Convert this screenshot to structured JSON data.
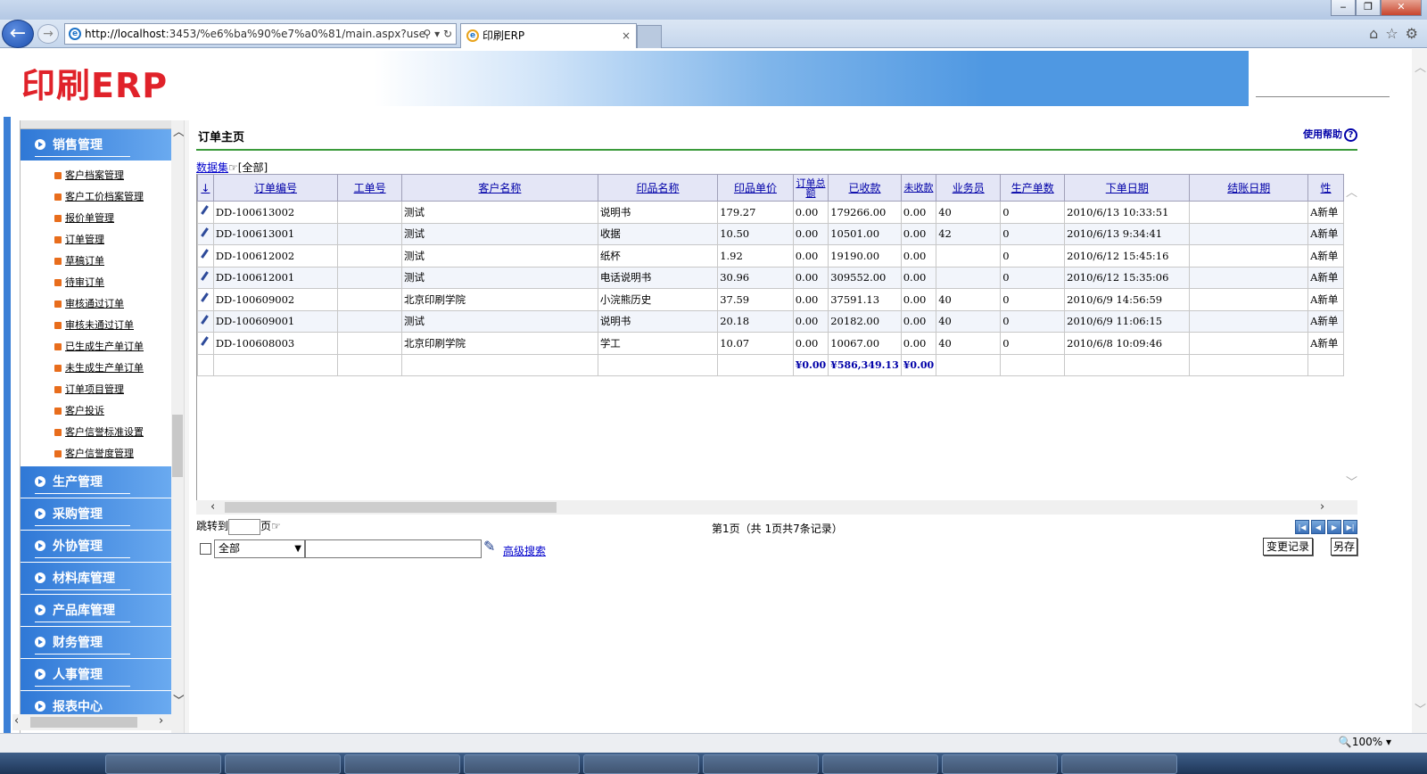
{
  "browser": {
    "address": "http://localhost:3453/%e6%ba%90%e7%a0%81/main.aspx?use",
    "address_host": "http://localhost",
    "address_rest": ":3453/%e6%ba%90%e7%a0%81/main.aspx?use",
    "tab_title": "印刷ERP",
    "zoom": "100%"
  },
  "header": {
    "logo": "印刷ERP"
  },
  "sidebar": {
    "sections": [
      {
        "label": "销售管理"
      },
      {
        "label": "生产管理"
      },
      {
        "label": "采购管理"
      },
      {
        "label": "外协管理"
      },
      {
        "label": "材料库管理"
      },
      {
        "label": "产品库管理"
      },
      {
        "label": "财务管理"
      },
      {
        "label": "人事管理"
      },
      {
        "label": "报表中心"
      }
    ],
    "sales_items": [
      "客户档案管理",
      "客户工价档案管理",
      "报价单管理",
      "订单管理",
      "草稿订单",
      "待审订单",
      "审核通过订单",
      "审核未通过订单",
      "已生成生产单订单",
      "未生成生产单订单",
      "订单项目管理",
      "客户投诉",
      "客户信誉标准设置",
      "客户信誉度管理"
    ]
  },
  "main": {
    "title": "订单主页",
    "help": "使用帮助",
    "dataset_label": "数据集",
    "dataset_value": "[全部]",
    "columns": [
      "↓",
      "订单编号",
      "工单号",
      "客户名称",
      "印品名称",
      "印品单价",
      "订单总额",
      "已收款",
      "未收款",
      "业务员",
      "生产单数",
      "下单日期",
      "结账日期",
      "性"
    ],
    "rows": [
      [
        "DD-100613002",
        "",
        "测试",
        "说明书",
        "179.27",
        "0.00",
        "179266.00",
        "0.00",
        "40",
        "0",
        "2010/6/13 10:33:51",
        "",
        "A新单"
      ],
      [
        "DD-100613001",
        "",
        "测试",
        "收据",
        "10.50",
        "0.00",
        "10501.00",
        "0.00",
        "42",
        "0",
        "2010/6/13 9:34:41",
        "",
        "A新单"
      ],
      [
        "DD-100612002",
        "",
        "测试",
        "纸杯",
        "1.92",
        "0.00",
        "19190.00",
        "0.00",
        "",
        "0",
        "2010/6/12 15:45:16",
        "",
        "A新单"
      ],
      [
        "DD-100612001",
        "",
        "测试",
        "电话说明书",
        "30.96",
        "0.00",
        "309552.00",
        "0.00",
        "",
        "0",
        "2010/6/12 15:35:06",
        "",
        "A新单"
      ],
      [
        "DD-100609002",
        "",
        "北京印刷学院",
        "小浣熊历史",
        "37.59",
        "0.00",
        "37591.13",
        "0.00",
        "40",
        "0",
        "2010/6/9 14:56:59",
        "",
        "A新单"
      ],
      [
        "DD-100609001",
        "",
        "测试",
        "说明书",
        "20.18",
        "0.00",
        "20182.00",
        "0.00",
        "40",
        "0",
        "2010/6/9 11:06:15",
        "",
        "A新单"
      ],
      [
        "DD-100608003",
        "",
        "北京印刷学院",
        "学工",
        "10.07",
        "0.00",
        "10067.00",
        "0.00",
        "40",
        "0",
        "2010/6/8 10:09:46",
        "",
        "A新单"
      ]
    ],
    "totals": {
      "order_total": "¥0.00",
      "received": "¥586,349.13",
      "unreceived": "¥0.00"
    },
    "pager": {
      "jump_label": "跳转到",
      "page_suffix": "页",
      "info": "第1页（共 1页共7条记录）"
    },
    "search": {
      "scope": "全部",
      "advanced": "高级搜索"
    },
    "buttons": {
      "change": "变更记录",
      "saveas": "另存"
    }
  }
}
